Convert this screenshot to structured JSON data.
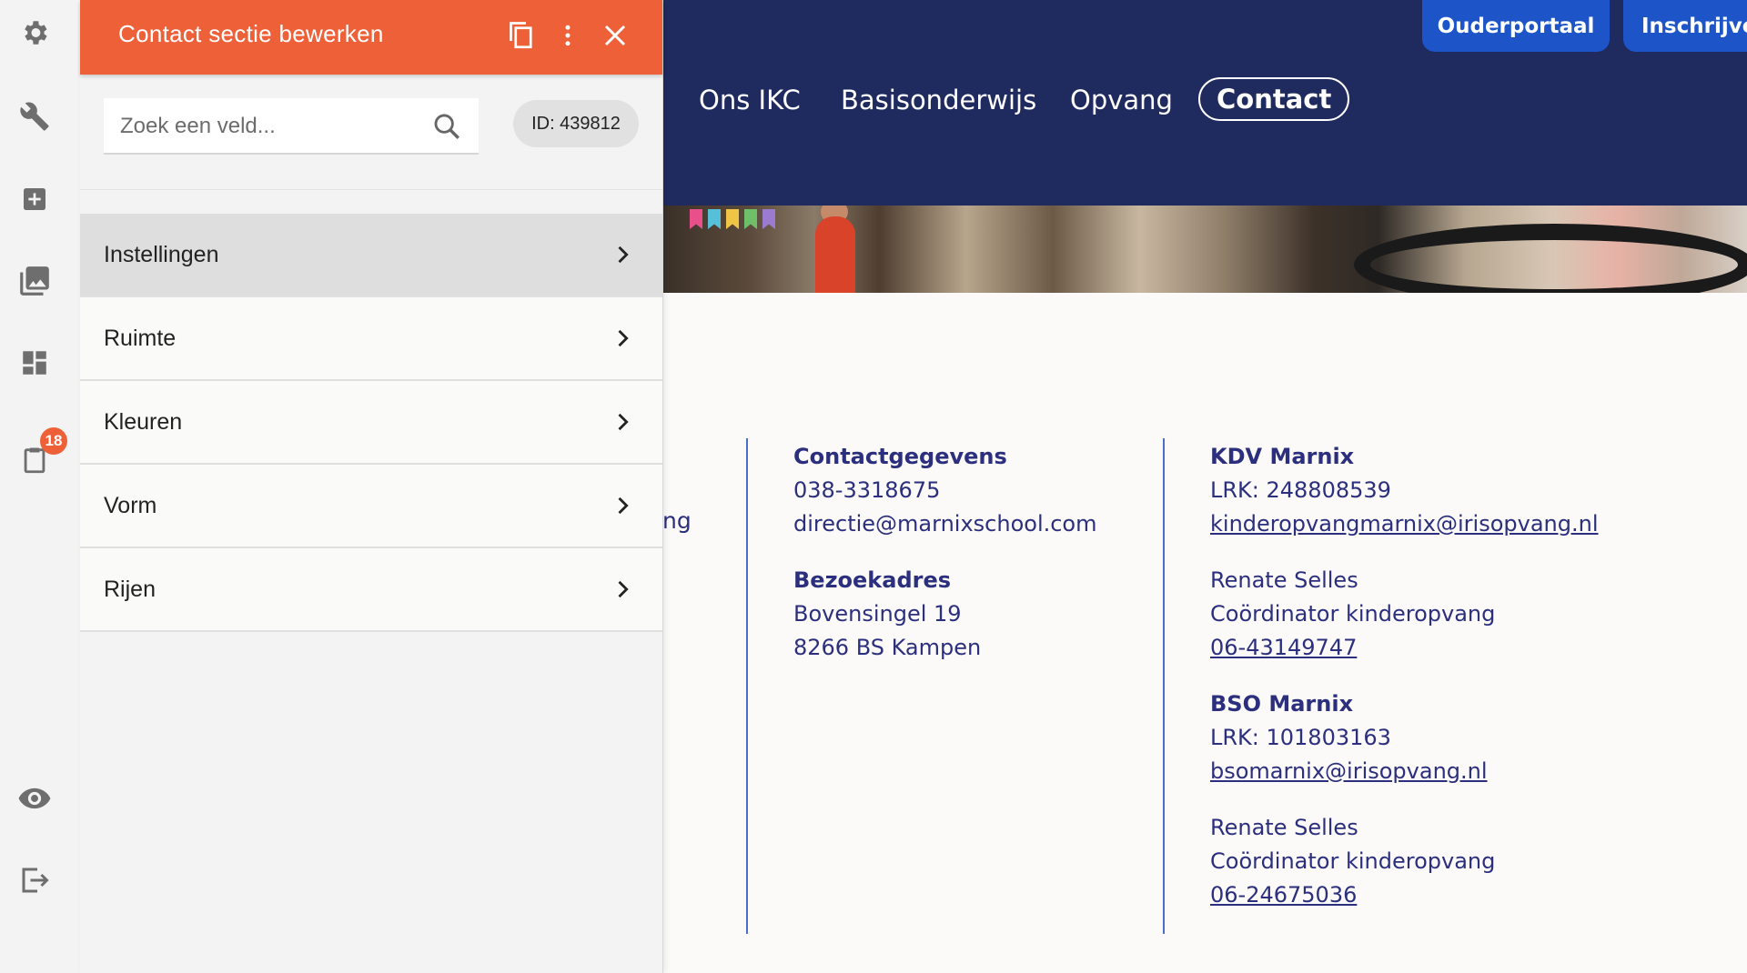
{
  "editor": {
    "title": "Contact sectie bewerken",
    "search_placeholder": "Zoek een veld...",
    "id_label": "ID: 439812",
    "menu": [
      {
        "label": "Instellingen",
        "active": true
      },
      {
        "label": "Ruimte"
      },
      {
        "label": "Kleuren"
      },
      {
        "label": "Vorm"
      },
      {
        "label": "Rijen"
      }
    ],
    "header_icons": [
      "copy-icon",
      "more-vertical-icon",
      "close-icon"
    ]
  },
  "rail": {
    "icons": [
      "gear-icon",
      "wrench-icon",
      "add-box-icon",
      "images-icon",
      "dashboard-icon",
      "clipboard-icon",
      "eye-icon",
      "logout-icon"
    ],
    "badge_count": "18"
  },
  "site": {
    "top_buttons": {
      "parent_portal": "Ouderportaal",
      "register": "Inschrijven"
    },
    "nav": [
      "Ons IKC",
      "Basisonderwijs",
      "Opvang",
      "Contact"
    ],
    "nav_active": "Contact",
    "partial_text": "ng",
    "contact": {
      "details_heading": "Contactgegevens",
      "phone": "038-3318675",
      "email": "directie@marnixschool.com",
      "visit_heading": "Bezoekadres",
      "street": "Bovensingel 19",
      "city": "8266 BS Kampen"
    },
    "kdv": {
      "heading": "KDV Marnix",
      "lrk": "LRK: 248808539",
      "email": "kinderopvangmarnix@irisopvang.nl",
      "person": "Renate Selles",
      "role": "Coördinator kinderopvang",
      "phone": "06-43149747"
    },
    "bso": {
      "heading": "BSO Marnix",
      "lrk": "LRK: 101803163",
      "email": "bsomarnix@irisopvang.nl",
      "person": "Renate Selles",
      "role": "Coördinator kinderopvang",
      "phone": "06-24675036"
    }
  },
  "colors": {
    "accent": "#ee6038",
    "header_navy": "#1f2a5f",
    "button_blue": "#1d55c9",
    "text_navy": "#2b2f7d"
  }
}
